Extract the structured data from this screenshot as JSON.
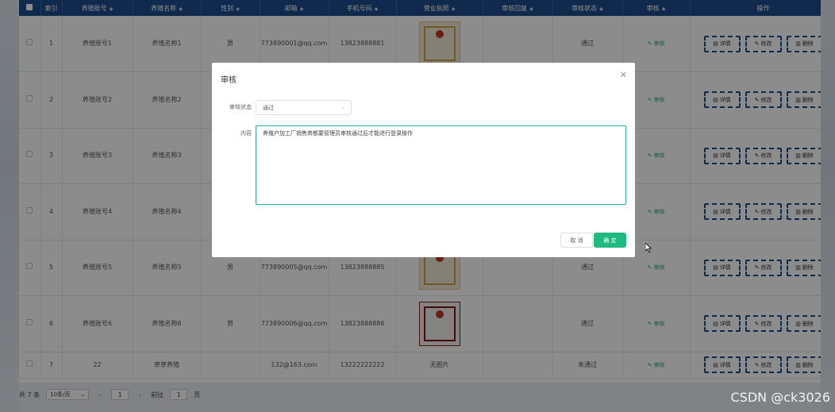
{
  "table": {
    "headers": [
      "",
      "索引",
      "养殖账号",
      "养殖名称",
      "性别",
      "邮箱",
      "手机号码",
      "营业执照",
      "审核回复",
      "审核状态",
      "审核",
      "操作"
    ],
    "rows": [
      {
        "index": "1",
        "account": "养殖账号1",
        "name": "养殖名称1",
        "gender": "男",
        "email": "773890001@qq.com",
        "phone": "13823888881",
        "license": "image",
        "reply": "",
        "status": "通过",
        "audit": "审核"
      },
      {
        "index": "2",
        "account": "养殖账号2",
        "name": "养殖名称2",
        "gender": "",
        "email": "",
        "phone": "",
        "license": "",
        "reply": "",
        "status": "",
        "audit": "审核"
      },
      {
        "index": "3",
        "account": "养殖账号3",
        "name": "养殖名称3",
        "gender": "",
        "email": "",
        "phone": "",
        "license": "",
        "reply": "",
        "status": "",
        "audit": "审核"
      },
      {
        "index": "4",
        "account": "养殖账号4",
        "name": "养殖名称4",
        "gender": "",
        "email": "",
        "phone": "",
        "license": "",
        "reply": "",
        "status": "",
        "audit": "审核"
      },
      {
        "index": "5",
        "account": "养殖账号5",
        "name": "养殖名称5",
        "gender": "男",
        "email": "773890005@qq.com",
        "phone": "13823888885",
        "license": "image",
        "reply": "",
        "status": "通过",
        "audit": "审核"
      },
      {
        "index": "6",
        "account": "养殖账号6",
        "name": "养殖名称6",
        "gender": "男",
        "email": "773890006@qq.com",
        "phone": "13823888886",
        "license": "image-red",
        "reply": "",
        "status": "通过",
        "audit": "审核"
      },
      {
        "index": "7",
        "account": "22",
        "name": "草草养殖",
        "gender": "",
        "email": "132@163.com",
        "phone": "13222222222",
        "license": "无图片",
        "reply": "",
        "status": "未通过",
        "audit": "审核"
      }
    ],
    "ops": {
      "detail": "详情",
      "edit": "修改",
      "delete": "删除"
    }
  },
  "pager": {
    "total": "共 7 条",
    "page_size": "10条/页",
    "current": "1",
    "goto_label": "前往",
    "goto_value": "1",
    "page_suffix": "页"
  },
  "dialog": {
    "title": "审核",
    "status_label": "审核状态",
    "status_value": "通过",
    "content_label": "内容",
    "content_value": "养殖户加工厂销售商都要管理员审核通过后才能进行登录操作",
    "cancel": "取 消",
    "ok": "确 定"
  },
  "watermark": "CSDN @ck3026",
  "colors": {
    "header": "#1e4d8c",
    "accent": "#1fb981",
    "focus": "#2aa8a8"
  }
}
